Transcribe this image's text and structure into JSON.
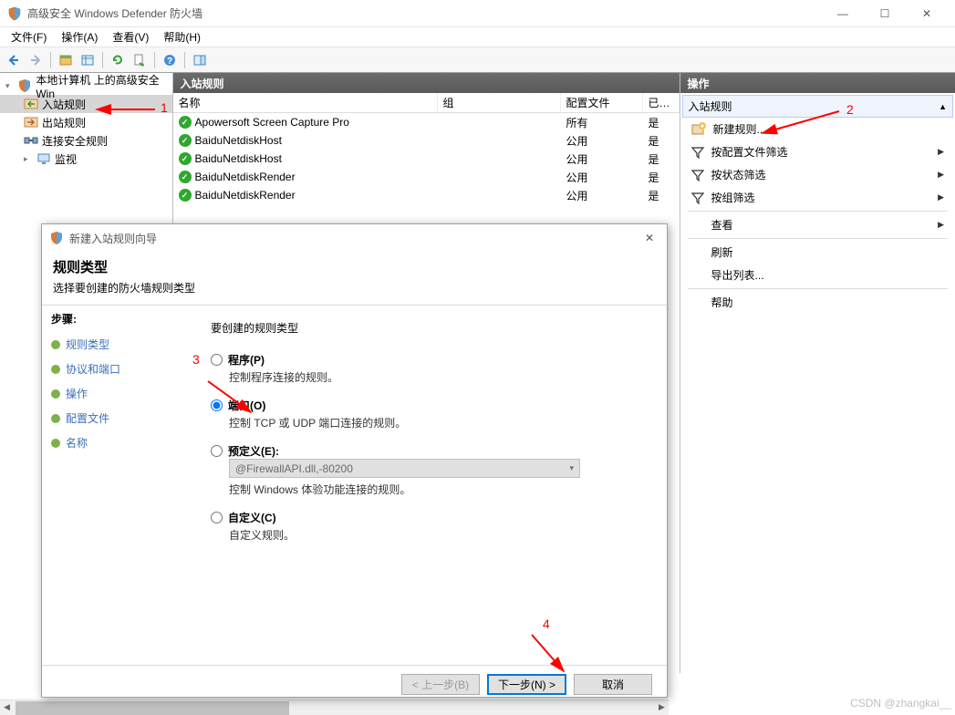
{
  "window": {
    "title": "高级安全 Windows Defender 防火墙",
    "minimize": "—",
    "maximize": "☐",
    "close": "✕"
  },
  "menubar": {
    "file": "文件(F)",
    "action": "操作(A)",
    "view": "查看(V)",
    "help": "帮助(H)"
  },
  "tree": {
    "root": "本地计算机 上的高级安全 Win",
    "inbound": "入站规则",
    "outbound": "出站规则",
    "connsec": "连接安全规则",
    "monitor": "监视"
  },
  "center": {
    "header": "入站规则",
    "cols": {
      "name": "名称",
      "group": "组",
      "profile": "配置文件",
      "enabled": "已…"
    },
    "rows": [
      {
        "name": "Apowersoft Screen Capture Pro",
        "profile": "所有",
        "enabled": "是"
      },
      {
        "name": "BaiduNetdiskHost",
        "profile": "公用",
        "enabled": "是"
      },
      {
        "name": "BaiduNetdiskHost",
        "profile": "公用",
        "enabled": "是"
      },
      {
        "name": "BaiduNetdiskRender",
        "profile": "公用",
        "enabled": "是"
      },
      {
        "name": "BaiduNetdiskRender",
        "profile": "公用",
        "enabled": "是"
      }
    ]
  },
  "actions": {
    "header": "操作",
    "section": "入站规则",
    "newrule": "新建规则...",
    "filter_profile": "按配置文件筛选",
    "filter_state": "按状态筛选",
    "filter_group": "按组筛选",
    "view": "查看",
    "refresh": "刷新",
    "export": "导出列表...",
    "help": "帮助"
  },
  "wizard": {
    "title": "新建入站规则向导",
    "heading": "规则类型",
    "subheading": "选择要创建的防火墙规则类型",
    "steps_label": "步骤:",
    "steps": {
      "ruletype": "规则类型",
      "protocol": "协议和端口",
      "operation": "操作",
      "profile": "配置文件",
      "name": "名称"
    },
    "question": "要创建的规则类型",
    "opts": {
      "program": {
        "label": "程序(P)",
        "desc": "控制程序连接的规则。"
      },
      "port": {
        "label": "端口(O)",
        "desc": "控制 TCP 或 UDP 端口连接的规则。"
      },
      "predefined": {
        "label": "预定义(E):",
        "select": "@FirewallAPI.dll,-80200",
        "desc": "控制 Windows 体验功能连接的规则。"
      },
      "custom": {
        "label": "自定义(C)",
        "desc": "自定义规则。"
      }
    },
    "btn_back": "< 上一步(B)",
    "btn_next": "下一步(N) >",
    "btn_cancel": "取消"
  },
  "annotations": {
    "a1": "1",
    "a2": "2",
    "a3": "3",
    "a4": "4"
  },
  "watermark": "CSDN @zhangkai__"
}
